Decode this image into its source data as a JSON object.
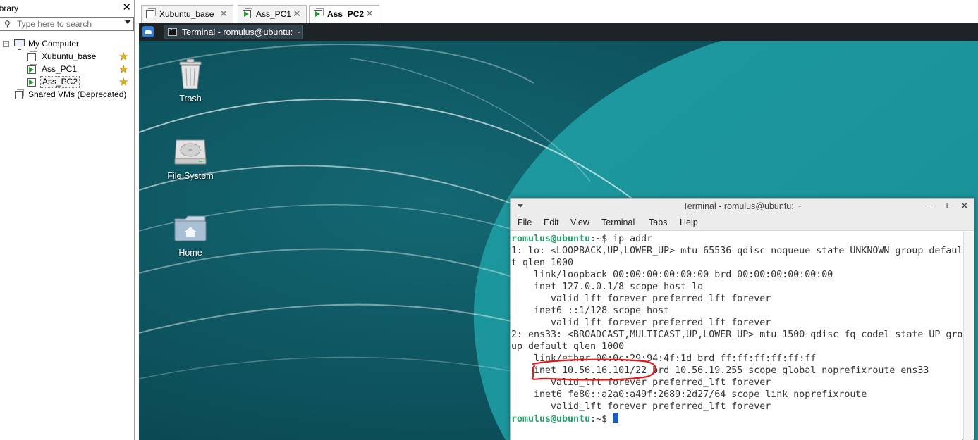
{
  "library": {
    "title": "ibrary",
    "search_placeholder": "Type here to search",
    "root_label": "My Computer",
    "items": [
      {
        "label": "Xubuntu_base"
      },
      {
        "label": "Ass_PC1"
      },
      {
        "label": "Ass_PC2"
      }
    ],
    "shared_label": "Shared VMs (Deprecated)"
  },
  "tabs": [
    {
      "label": "Xubuntu_base"
    },
    {
      "label": "Ass_PC1"
    },
    {
      "label": "Ass_PC2"
    }
  ],
  "vm": {
    "taskbar_label": "Terminal - romulus@ubuntu: ~",
    "desktop_icons": [
      {
        "label": "Trash"
      },
      {
        "label": "File System"
      },
      {
        "label": "Home"
      }
    ]
  },
  "terminal": {
    "title": "Terminal - romulus@ubuntu: ~",
    "menu": [
      "File",
      "Edit",
      "View",
      "Terminal",
      "Tabs",
      "Help"
    ],
    "prompt": "romulus@ubuntu",
    "prompt_suffix": ":~$ ",
    "command": "ip addr",
    "lines": [
      "1: lo: <LOOPBACK,UP,LOWER_UP> mtu 65536 qdisc noqueue state UNKNOWN group defaul",
      "t qlen 1000",
      "    link/loopback 00:00:00:00:00:00 brd 00:00:00:00:00:00",
      "    inet 127.0.0.1/8 scope host lo",
      "       valid_lft forever preferred_lft forever",
      "    inet6 ::1/128 scope host",
      "       valid_lft forever preferred_lft forever",
      "2: ens33: <BROADCAST,MULTICAST,UP,LOWER_UP> mtu 1500 qdisc fq_codel state UP gro",
      "up default qlen 1000",
      "    link/ether 00:0c:29:94:4f:1d brd ff:ff:ff:ff:ff:ff",
      "    inet 10.56.16.101/22 brd 10.56.19.255 scope global noprefixroute ens33",
      "       valid_lft forever preferred_lft forever",
      "    inet6 fe80::a2a0:a49f:2689:2d27/64 scope link noprefixroute",
      "       valid_lft forever preferred_lft forever"
    ]
  },
  "colors": {
    "annotation_red": "#e01818",
    "prompt_green": "#26a269",
    "wallpaper_dark": "#0b4c55",
    "wallpaper_light": "#1f9aa0"
  }
}
